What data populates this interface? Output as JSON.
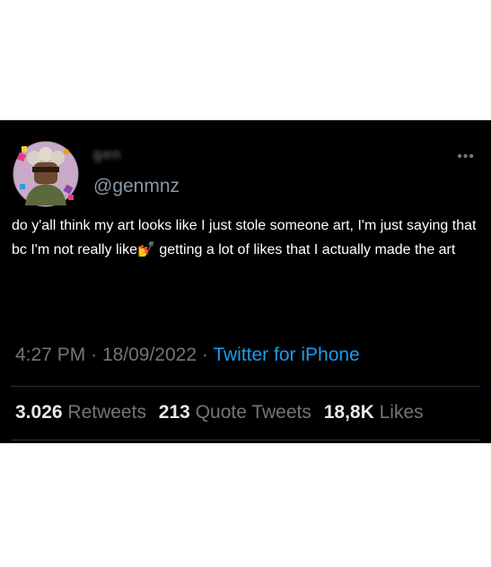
{
  "tweet": {
    "display_name": "gen",
    "handle": "@genmnz",
    "more_label": "•••",
    "text_part1": "do y'all think my art looks like I just stole someone art, I'm just saying that bc I'm not really like",
    "emoji": "💅",
    "text_part2": " getting a lot of likes that I actually made the art",
    "time": "4:27 PM",
    "separator": "·",
    "date": "18/09/2022",
    "source": "Twitter for iPhone"
  },
  "stats": {
    "retweets_count": "3.026",
    "retweets_label": "Retweets",
    "quotes_count": "213",
    "quotes_label": "Quote Tweets",
    "likes_count": "18,8K",
    "likes_label": "Likes"
  },
  "colors": {
    "background": "#000000",
    "text": "#ffffff",
    "secondary": "#6e767d",
    "link": "#1d9bf0"
  }
}
